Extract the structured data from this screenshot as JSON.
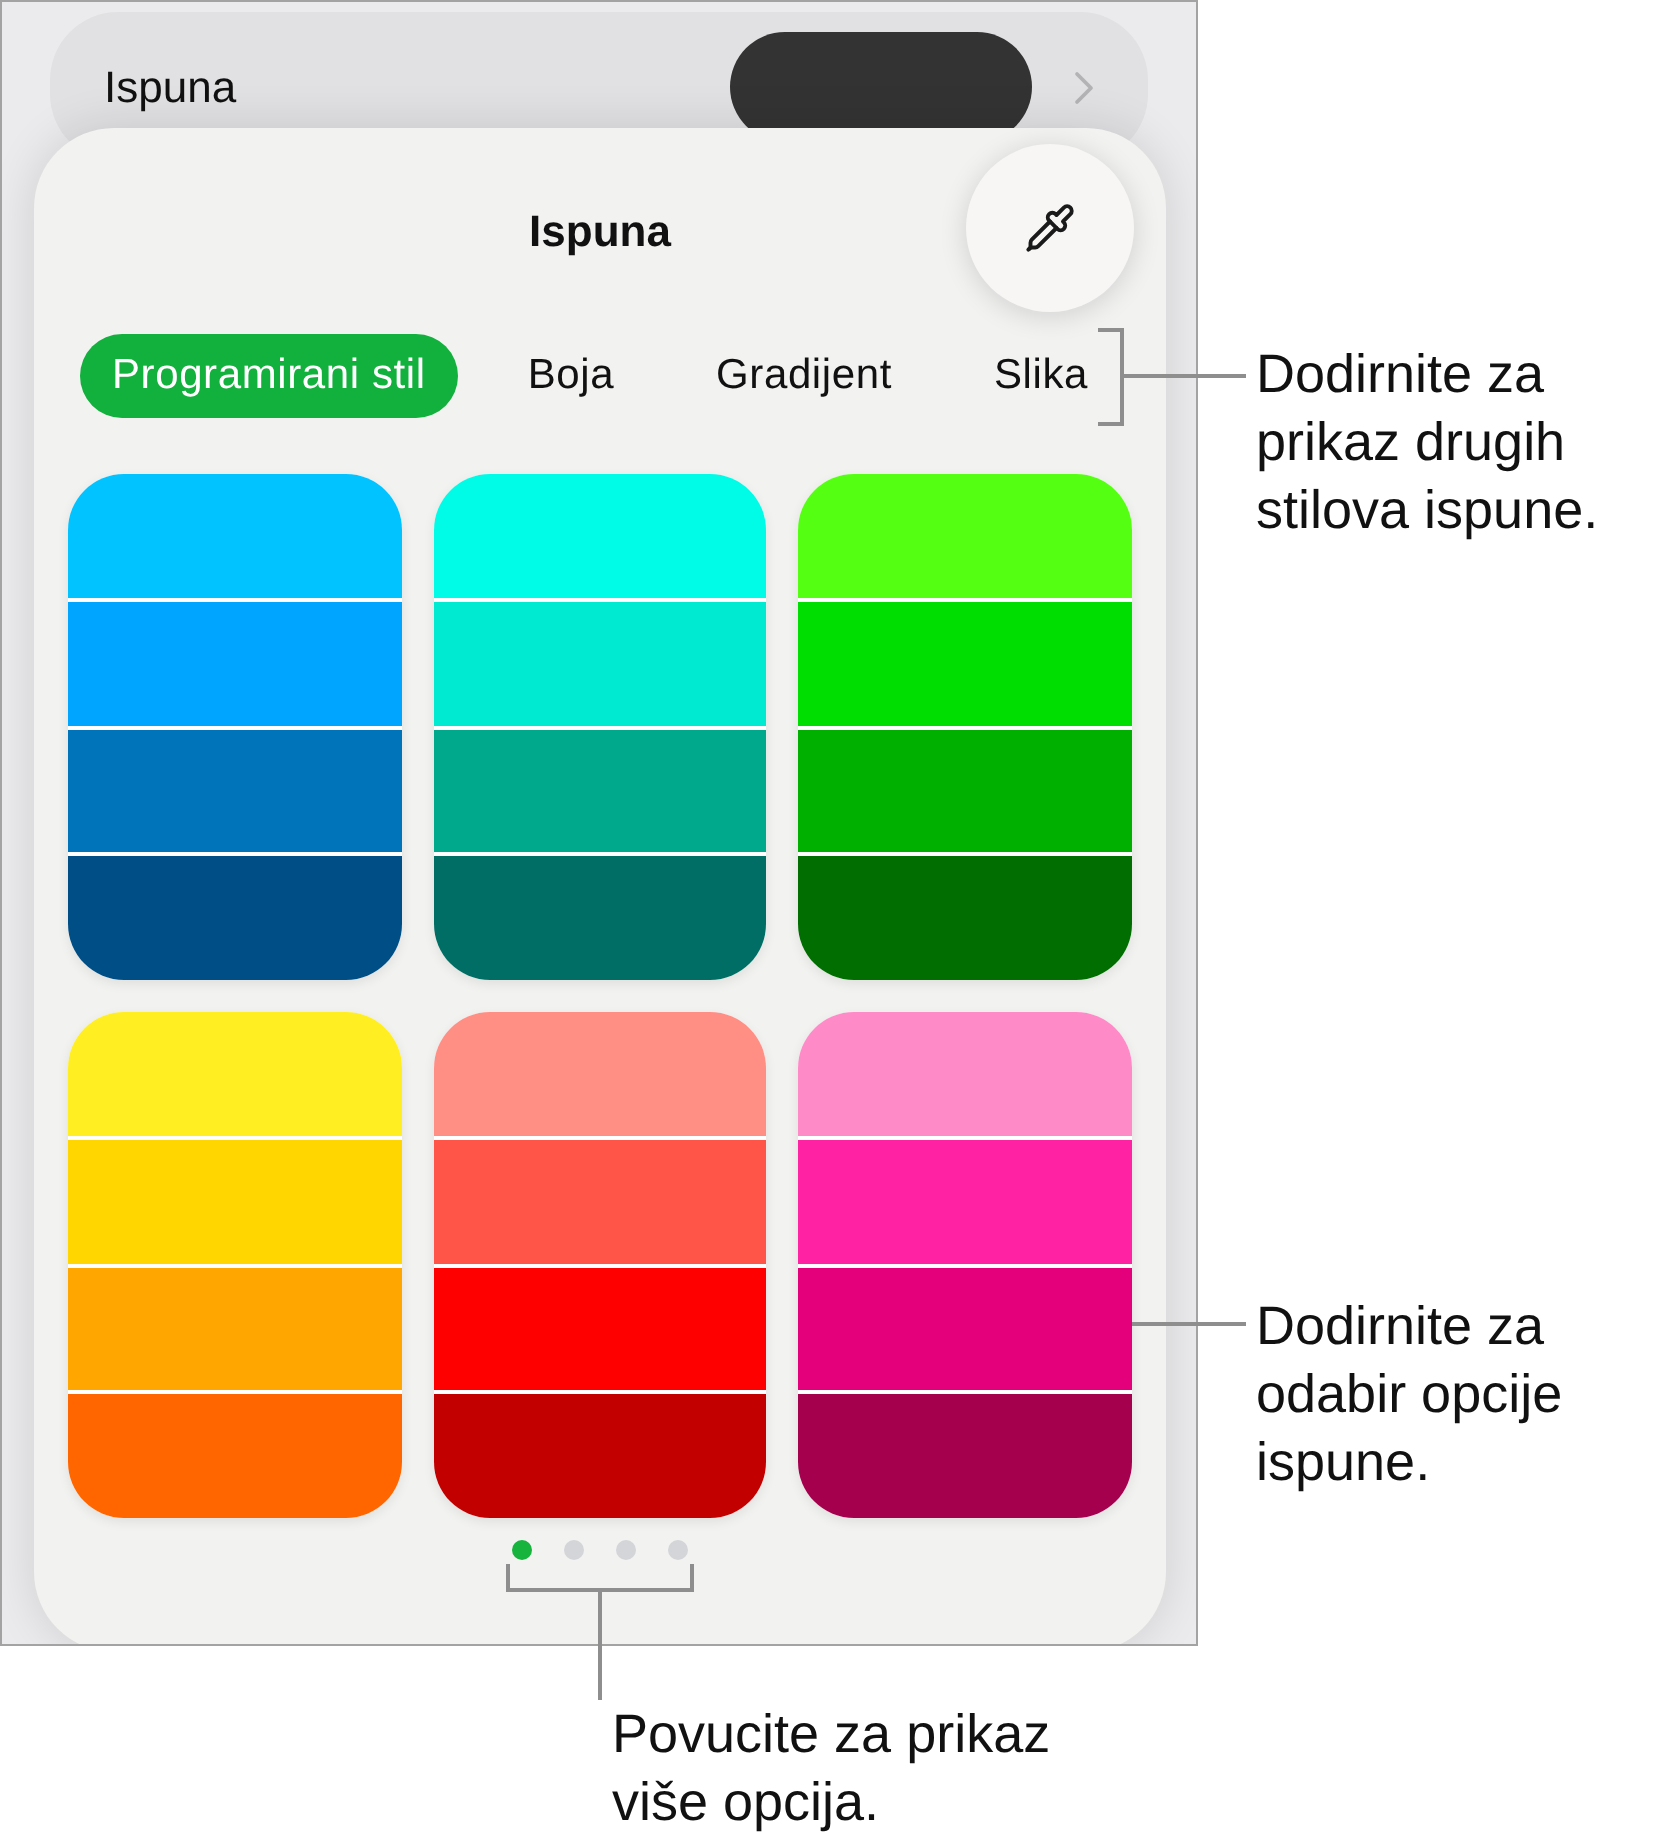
{
  "fill_row": {
    "label": "Ispuna"
  },
  "popover": {
    "title": "Ispuna"
  },
  "tabs": [
    {
      "label": "Programirani stil",
      "selected": true
    },
    {
      "label": "Boja",
      "selected": false
    },
    {
      "label": "Gradijent",
      "selected": false
    },
    {
      "label": "Slika",
      "selected": false
    }
  ],
  "swatches": [
    {
      "bands": [
        {
          "color": "#00c3ff"
        },
        {
          "color": "#00a5ff"
        },
        {
          "color": "#0074ba"
        },
        {
          "color": "#004e86"
        }
      ]
    },
    {
      "bands": [
        {
          "color": "#00fbe6"
        },
        {
          "color": "#00ead2"
        },
        {
          "color": "#00a88c"
        },
        {
          "color": "#006e64"
        }
      ]
    },
    {
      "bands": [
        {
          "color": "#55ff12"
        },
        {
          "color": "#00dd00"
        },
        {
          "color": "#00b000"
        },
        {
          "color": "#006e00"
        }
      ]
    },
    {
      "bands": [
        {
          "color": "#ffee22"
        },
        {
          "color": "#ffd600"
        },
        {
          "color": "#ffa600"
        },
        {
          "color": "#ff6600"
        }
      ]
    },
    {
      "bands": [
        {
          "color": "#ff8e84"
        },
        {
          "color": "#ff5548"
        },
        {
          "color": "#ff0000"
        },
        {
          "color": "#c20000"
        }
      ]
    },
    {
      "bands": [
        {
          "color": "#ff8ac8"
        },
        {
          "color": "#ff22a2"
        },
        {
          "color": "#e4007a"
        },
        {
          "color": "#a4004e"
        }
      ]
    }
  ],
  "page_dots": [
    {
      "selected": true
    },
    {
      "selected": false
    },
    {
      "selected": false
    },
    {
      "selected": false
    }
  ],
  "callouts": [
    {
      "text": "Dodirnite za prikaz drugih stilova ispune."
    },
    {
      "text": "Dodirnite za odabir opcije ispune."
    },
    {
      "text": "Povucite za prikaz više opcija."
    }
  ]
}
